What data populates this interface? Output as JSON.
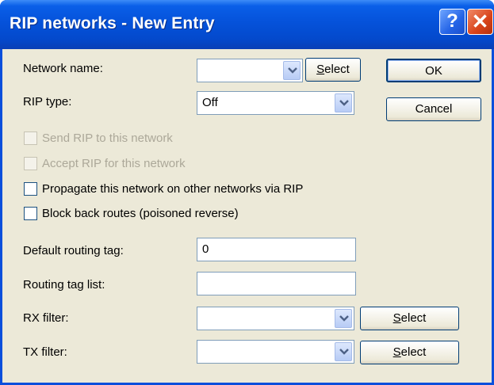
{
  "window": {
    "title": "RIP networks - New Entry",
    "help_glyph": "?",
    "close_glyph": "✕"
  },
  "form": {
    "network_name": {
      "label": "Network name:",
      "value": "",
      "select_hotkey": "S",
      "select_rest": "elect"
    },
    "rip_type": {
      "label": "RIP type:",
      "value": "Off"
    },
    "send_rip": {
      "label": "Send RIP to this network",
      "checked": false,
      "enabled": false
    },
    "accept_rip": {
      "label": "Accept RIP for this network",
      "checked": false,
      "enabled": false
    },
    "propagate": {
      "label": "Propagate this network on other networks via RIP",
      "checked": false
    },
    "block_back": {
      "label": "Block back routes (poisoned reverse)",
      "checked": false
    },
    "default_tag": {
      "label": "Default routing tag:",
      "value": "0"
    },
    "tag_list": {
      "label": "Routing tag list:",
      "value": ""
    },
    "rx_filter": {
      "label": "RX filter:",
      "value": "",
      "select_hotkey": "S",
      "select_rest": "elect"
    },
    "tx_filter": {
      "label": "TX filter:",
      "value": "",
      "select_hotkey": "S",
      "select_rest": "elect"
    }
  },
  "buttons": {
    "ok": "OK",
    "cancel": "Cancel"
  }
}
